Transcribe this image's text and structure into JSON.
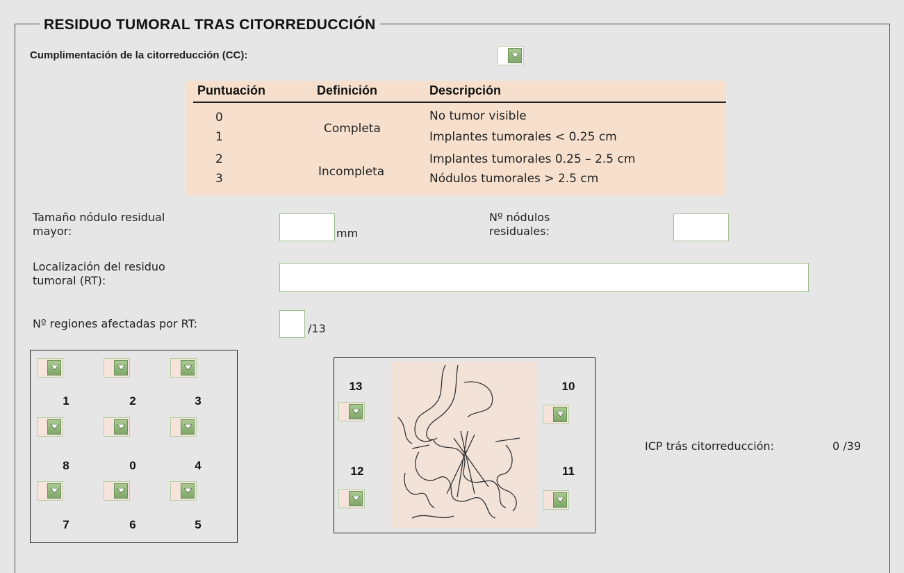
{
  "section": {
    "title": "RESIDUO TUMORAL TRAS CITORREDUCCIÓN"
  },
  "cc": {
    "label": "Cumplimentación de la citorreducción (CC):",
    "value": ""
  },
  "table": {
    "headers": [
      "Puntuación",
      "Definición",
      "Descripción"
    ],
    "scores": [
      "0",
      "1",
      "2",
      "3"
    ],
    "definitions": [
      "Completa",
      "Incompleta"
    ],
    "descriptions": [
      "No tumor visible",
      "Implantes tumorales < 0.25 cm",
      "Implantes tumorales 0.25 – 2.5 cm",
      "Nódulos tumorales > 2.5 cm"
    ]
  },
  "fields": {
    "size_label_1": "Tamaño nódulo residual",
    "size_label_2": "mayor:",
    "size_unit": "mm",
    "size_value": "",
    "count_label_1": "Nº nódulos",
    "count_label_2": "residuales:",
    "count_value": "",
    "loc_label_1": "Localización del residuo",
    "loc_label_2": "tumoral (RT):",
    "loc_value": "",
    "regions_label": "Nº regiones afectadas por RT:",
    "regions_value": "",
    "regions_total": "/13"
  },
  "grid": {
    "numbers": [
      "1",
      "2",
      "3",
      "8",
      "0",
      "4",
      "7",
      "6",
      "5"
    ]
  },
  "diagram": {
    "labels": [
      "13",
      "10",
      "12",
      "11"
    ]
  },
  "icp": {
    "label": "ICP trás citorreducción:",
    "value": "0 /39"
  },
  "colors": {
    "background": "#e6e6e6",
    "table_bg": "#f6e0cd",
    "select_arrow": "#8fb37a"
  }
}
